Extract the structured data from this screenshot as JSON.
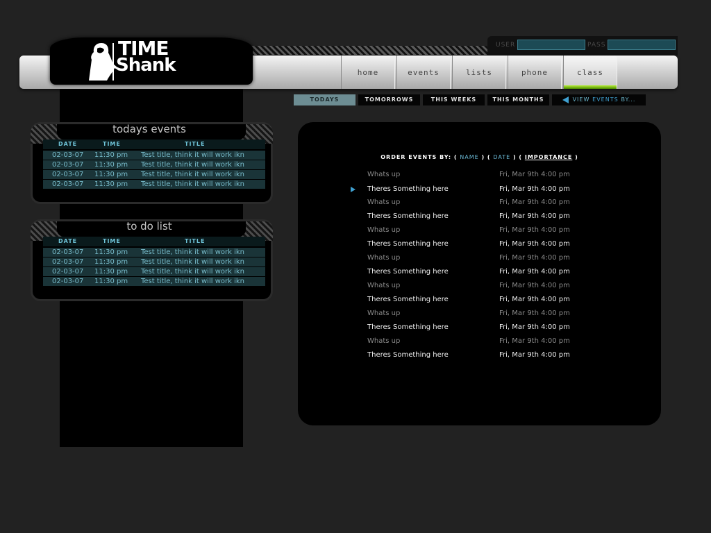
{
  "header": {
    "logo_line1": "TIME",
    "logo_line2": "Shank",
    "login": {
      "user_label": "USER",
      "pass_label": "PASS",
      "user_value": "",
      "pass_value": ""
    },
    "nav": [
      "home",
      "events",
      "lists",
      "phone",
      "class"
    ],
    "active_nav": "class"
  },
  "subtabs": {
    "todays": "TODAYS",
    "tomorrows": "TOMORROWS",
    "this_weeks": "THIS WEEKS",
    "this_months": "THIS MONTHS",
    "view_by_prefix": "VIEW",
    "view_by_events": "EVENTS",
    "view_by_suffix": "BY..."
  },
  "todays_events": {
    "title": "todays events",
    "columns": [
      "DATE",
      "TIME",
      "TITLE"
    ],
    "rows": [
      {
        "date": "02-03-07",
        "time": "11:30 pm",
        "title": "Test title, think it will work ikn"
      },
      {
        "date": "02-03-07",
        "time": "11:30 pm",
        "title": "Test title, think it will work ikn"
      },
      {
        "date": "02-03-07",
        "time": "11:30 pm",
        "title": "Test title, think it will work ikn"
      },
      {
        "date": "02-03-07",
        "time": "11:30 pm",
        "title": "Test title, think it will work ikn"
      }
    ]
  },
  "todo_list": {
    "title": "to do list",
    "columns": [
      "DATE",
      "TIME",
      "TITLE"
    ],
    "rows": [
      {
        "date": "02-03-07",
        "time": "11:30 pm",
        "title": "Test title, think it will work ikn"
      },
      {
        "date": "02-03-07",
        "time": "11:30 pm",
        "title": "Test title, think it will work ikn"
      },
      {
        "date": "02-03-07",
        "time": "11:30 pm",
        "title": "Test title, think it will work ikn"
      },
      {
        "date": "02-03-07",
        "time": "11:30 pm",
        "title": "Test title, think it will work ikn"
      }
    ]
  },
  "main": {
    "order_label": "ORDER EVENTS BY:",
    "order_name": "NAME",
    "order_date": "DATE",
    "order_importance": "IMPORTANCE",
    "events": [
      {
        "name": "Whats up",
        "date": "Fri, Mar 9th 4:00 pm"
      },
      {
        "name": "Theres Something here",
        "date": "Fri, Mar 9th 4:00 pm"
      },
      {
        "name": "Whats up",
        "date": "Fri, Mar 9th 4:00 pm"
      },
      {
        "name": "Theres Something here",
        "date": "Fri, Mar 9th 4:00 pm"
      },
      {
        "name": "Whats up",
        "date": "Fri, Mar 9th 4:00 pm"
      },
      {
        "name": "Theres Something here",
        "date": "Fri, Mar 9th 4:00 pm"
      },
      {
        "name": "Whats up",
        "date": "Fri, Mar 9th 4:00 pm"
      },
      {
        "name": "Theres Something here",
        "date": "Fri, Mar 9th 4:00 pm"
      },
      {
        "name": "Whats up",
        "date": "Fri, Mar 9th 4:00 pm"
      },
      {
        "name": "Theres Something here",
        "date": "Fri, Mar 9th 4:00 pm"
      },
      {
        "name": "Whats up",
        "date": "Fri, Mar 9th 4:00 pm"
      },
      {
        "name": "Theres Something here",
        "date": "Fri, Mar 9th 4:00 pm"
      },
      {
        "name": "Whats up",
        "date": "Fri, Mar 9th 4:00 pm"
      },
      {
        "name": "Theres Something here",
        "date": "Fri, Mar 9th 4:00 pm"
      }
    ]
  },
  "colors": {
    "background": "#222222",
    "accent_cyan": "#6fc4d8",
    "row_bg": "#1a3438",
    "active_green": "#8cd11f"
  }
}
